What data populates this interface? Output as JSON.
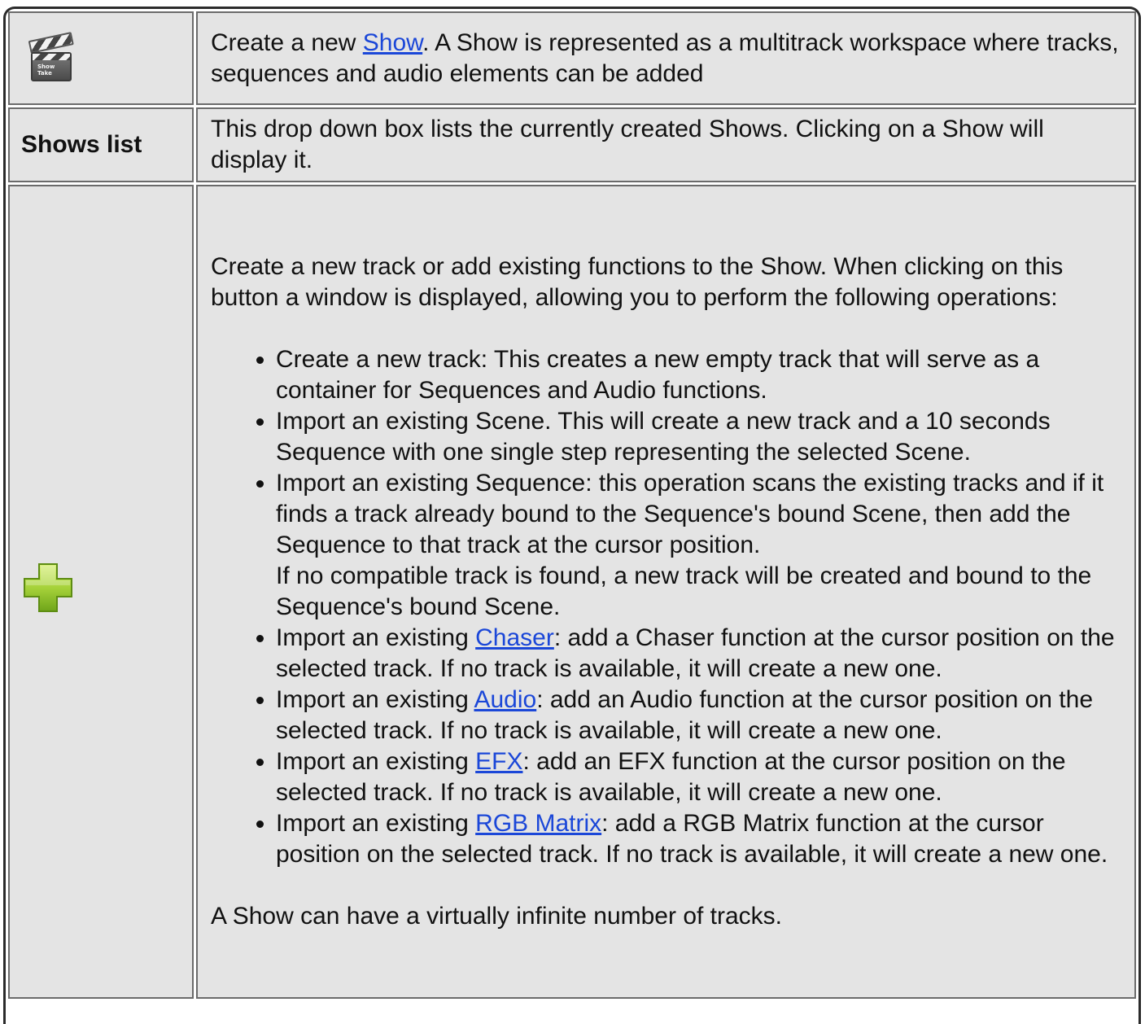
{
  "rows": [
    {
      "icon": "clapperboard-icon",
      "description_before_link": "Create a new ",
      "link": "Show",
      "description_after_link": ". A Show is represented as a multitrack workspace where tracks, sequences and audio elements can be added"
    },
    {
      "label": "Shows list",
      "description": "This drop down box lists the currently created Shows. Clicking on a Show will display it."
    },
    {
      "icon": "add-plus-icon",
      "intro": "Create a new track or add existing functions to the Show. When clicking on this button a window is displayed, allowing you to perform the following operations:",
      "items": [
        {
          "text": "Create a new track: This creates a new empty track that will serve as a container for Sequences and Audio functions."
        },
        {
          "text": "Import an existing Scene. This will create a new track and a 10 seconds Sequence with one single step representing the selected Scene."
        },
        {
          "text": "Import an existing Sequence: this operation scans the existing tracks and if it finds a track already bound to the Sequence's bound Scene, then add the Sequence to that track at the cursor position.",
          "extra": "If no compatible track is found, a new track will be created and bound to the Sequence's bound Scene."
        },
        {
          "before": "Import an existing ",
          "link": "Chaser",
          "after": ": add a Chaser function at the cursor position on the selected track. If no track is available, it will create a new one."
        },
        {
          "before": "Import an existing ",
          "link": "Audio",
          "after": ": add an Audio function at the cursor position on the selected track. If no track is available, it will create a new one."
        },
        {
          "before": "Import an existing ",
          "link": "EFX",
          "after": ": add an EFX function at the cursor position on the selected track. If no track is available, it will create a new one."
        },
        {
          "before": "Import an existing ",
          "link": "RGB Matrix",
          "after": ": add a RGB Matrix function at the cursor position on the selected track. If no track is available, it will create a new one."
        }
      ],
      "outro": "A Show can have a virtually infinite number of tracks."
    }
  ],
  "colors": {
    "cell_background": "#e4e4e4",
    "link": "#1b47d8",
    "plus_icon_green": "#9ccc2e"
  }
}
